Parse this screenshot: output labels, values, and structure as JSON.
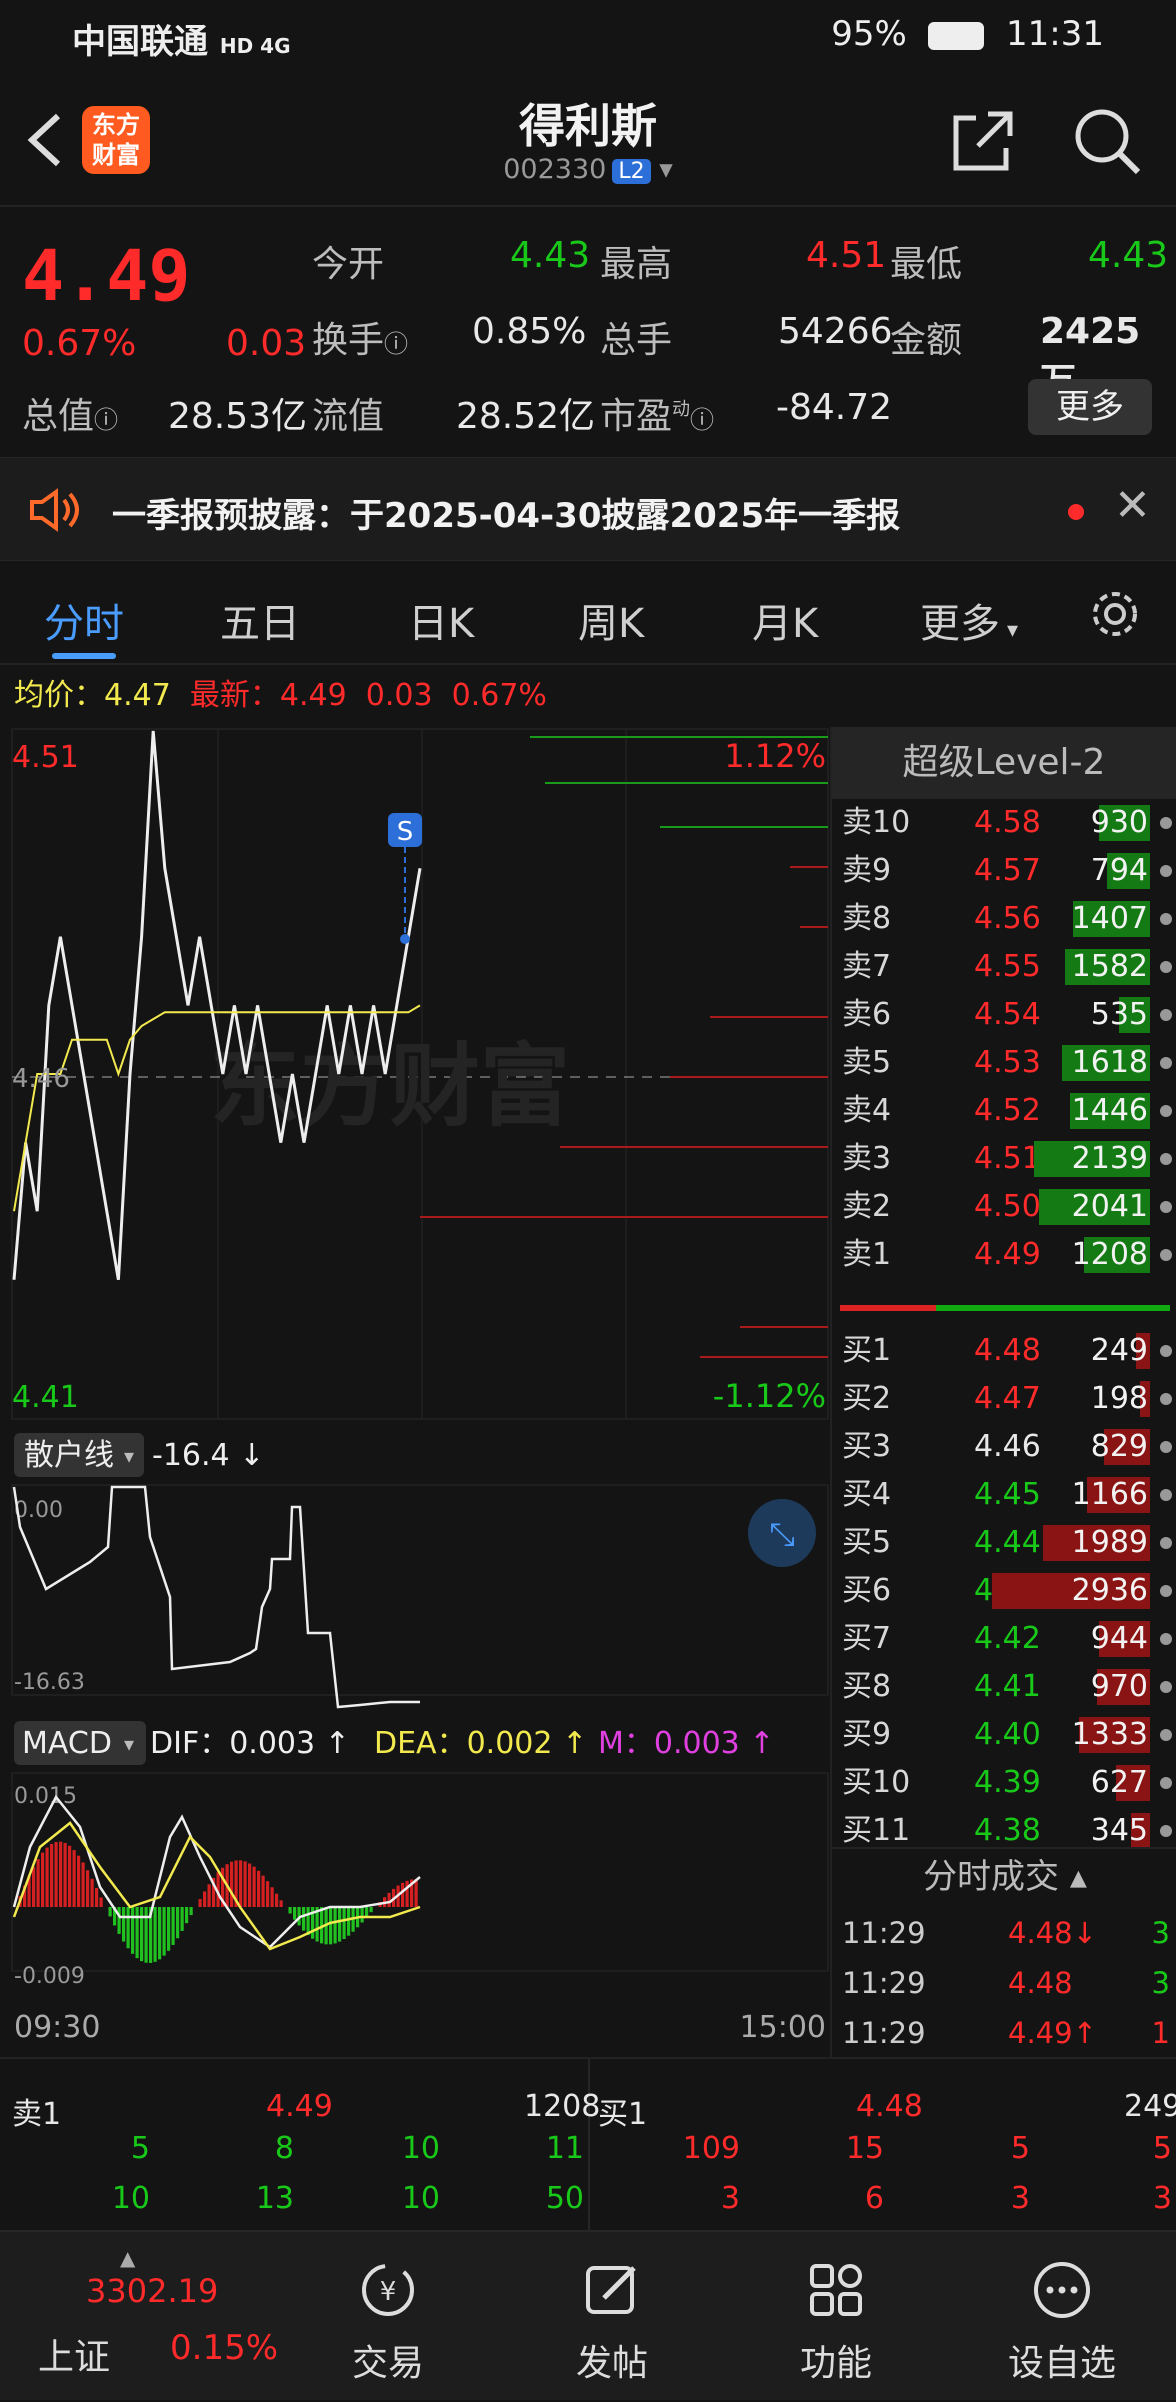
{
  "status": {
    "carrier": "中国联通",
    "net": "HD 4G",
    "battery": "95%",
    "time": "11:31"
  },
  "header": {
    "logo_line1": "东方",
    "logo_line2": "财富",
    "title": "得利斯",
    "code": "002330",
    "level": "L2"
  },
  "quote": {
    "price": "4.49",
    "change_pct": "0.67%",
    "change": "0.03",
    "open_label": "今开",
    "open": "4.43",
    "high_label": "最高",
    "high": "4.51",
    "low_label": "最低",
    "low": "4.43",
    "turnover_label": "换手",
    "turnover": "0.85%",
    "vol_label": "总手",
    "vol": "54266",
    "amount_label": "金额",
    "amount": "2425万",
    "mktcap_label": "总值",
    "mktcap": "28.53亿",
    "float_label": "流值",
    "float": "28.52亿",
    "pe_label": "市盈",
    "pe_sup": "动",
    "pe": "-84.72",
    "more": "更多"
  },
  "notice": {
    "text": "一季报预披露：于2025-04-30披露2025年一季报"
  },
  "tabs": [
    "分时",
    "五日",
    "日K",
    "周K",
    "月K",
    "更多",
    ""
  ],
  "info": {
    "avg_label": "均价：",
    "avg": "4.47",
    "last_label": "最新：",
    "last": "4.49",
    "chg": "0.03",
    "pct": "0.67%"
  },
  "chart": {
    "price_hi": "4.51",
    "price_mid": "4.46",
    "price_lo": "4.41",
    "pct_hi": "1.12%",
    "pct_lo": "-1.12%",
    "signal": "S",
    "retail_label": "散户线",
    "retail_value": "-16.4 ↓",
    "retail_hi": "0.00",
    "retail_lo": "-16.63",
    "macd_label": "MACD",
    "dif": "DIF：0.003 ↑",
    "dea": "DEA：0.002 ↑",
    "m": "M：0.003 ↑",
    "macd_hi": "0.015",
    "macd_lo": "-0.009",
    "t_start": "09:30",
    "t_end": "15:00"
  },
  "chart_data": {
    "type": "line",
    "x_range": [
      "09:30",
      "15:00"
    ],
    "ylim": [
      4.41,
      4.51
    ],
    "reference_price": 4.46,
    "series": [
      {
        "name": "最新",
        "values": [
          4.43,
          4.45,
          4.44,
          4.47,
          4.48,
          4.47,
          4.46,
          4.45,
          4.44,
          4.43,
          4.46,
          4.48,
          4.51,
          4.49,
          4.48,
          4.47,
          4.48,
          4.47,
          4.46,
          4.47,
          4.46,
          4.47,
          4.46,
          4.45,
          4.46,
          4.45,
          4.46,
          4.47,
          4.46,
          4.47,
          4.46,
          4.47,
          4.46,
          4.47,
          4.48,
          4.49
        ]
      },
      {
        "name": "均价",
        "values": [
          4.44,
          4.45,
          4.46,
          4.46,
          4.46,
          4.465,
          4.465,
          4.465,
          4.465,
          4.46,
          4.465,
          4.467,
          4.468,
          4.469,
          4.469,
          4.469,
          4.469,
          4.469,
          4.469,
          4.469,
          4.469,
          4.469,
          4.469,
          4.469,
          4.469,
          4.469,
          4.469,
          4.469,
          4.469,
          4.469,
          4.469,
          4.469,
          4.469,
          4.469,
          4.469,
          4.47
        ]
      }
    ]
  },
  "orderbook": {
    "title": "超级Level-2",
    "asks": [
      {
        "name": "卖10",
        "price": "4.58",
        "vol": "930",
        "bar": 0.3
      },
      {
        "name": "卖9",
        "price": "4.57",
        "vol": "794",
        "bar": 0.25
      },
      {
        "name": "卖8",
        "price": "4.56",
        "vol": "1407",
        "bar": 0.45
      },
      {
        "name": "卖7",
        "price": "4.55",
        "vol": "1582",
        "bar": 0.5
      },
      {
        "name": "卖6",
        "price": "4.54",
        "vol": "535",
        "bar": 0.18
      },
      {
        "name": "卖5",
        "price": "4.53",
        "vol": "1618",
        "bar": 0.52
      },
      {
        "name": "卖4",
        "price": "4.52",
        "vol": "1446",
        "bar": 0.47
      },
      {
        "name": "卖3",
        "price": "4.51",
        "vol": "2139",
        "bar": 0.68
      },
      {
        "name": "卖2",
        "price": "4.50",
        "vol": "2041",
        "bar": 0.65
      },
      {
        "name": "卖1",
        "price": "4.49",
        "vol": "1208",
        "bar": 0.39
      }
    ],
    "bids": [
      {
        "name": "买1",
        "price": "4.48",
        "vol": "249",
        "bar": 0.08
      },
      {
        "name": "买2",
        "price": "4.47",
        "vol": "198",
        "bar": 0.06
      },
      {
        "name": "买3",
        "price": "4.46",
        "vol": "829",
        "bar": 0.27
      },
      {
        "name": "买4",
        "price": "4.45",
        "vol": "1166",
        "bar": 0.37
      },
      {
        "name": "买5",
        "price": "4.44",
        "vol": "1989",
        "bar": 0.63
      },
      {
        "name": "买6",
        "price": "4.43",
        "vol": "2936",
        "bar": 0.93
      },
      {
        "name": "买7",
        "price": "4.42",
        "vol": "944",
        "bar": 0.3
      },
      {
        "name": "买8",
        "price": "4.41",
        "vol": "970",
        "bar": 0.31
      },
      {
        "name": "买9",
        "price": "4.40",
        "vol": "1333",
        "bar": 0.42
      },
      {
        "name": "买10",
        "price": "4.39",
        "vol": "627",
        "bar": 0.2
      },
      {
        "name": "买11",
        "price": "4.38",
        "vol": "345",
        "bar": 0.11
      }
    ],
    "trades_title": "分时成交",
    "trades": [
      {
        "time": "11:29",
        "price": "4.48↓",
        "vol": "3"
      },
      {
        "time": "11:29",
        "price": "4.48",
        "vol": "3"
      },
      {
        "time": "11:29",
        "price": "4.49↑",
        "vol": "1"
      }
    ]
  },
  "bottom": {
    "ask_label": "卖1",
    "ask_price": "4.49",
    "ask_vol": "1208",
    "bid_label": "买1",
    "bid_price": "4.48",
    "bid_vol": "249",
    "ask_q1": [
      "5",
      "8",
      "10",
      "11"
    ],
    "ask_q2": [
      "10",
      "13",
      "10",
      "50"
    ],
    "bid_q1": [
      "109",
      "15",
      "5",
      "5"
    ],
    "bid_q2": [
      "3",
      "6",
      "3",
      "3"
    ]
  },
  "nav": {
    "index_value": "3302.19",
    "index_name": "上证",
    "index_pct": "0.15%",
    "items": [
      "交易",
      "发帖",
      "功能",
      "设自选"
    ]
  }
}
